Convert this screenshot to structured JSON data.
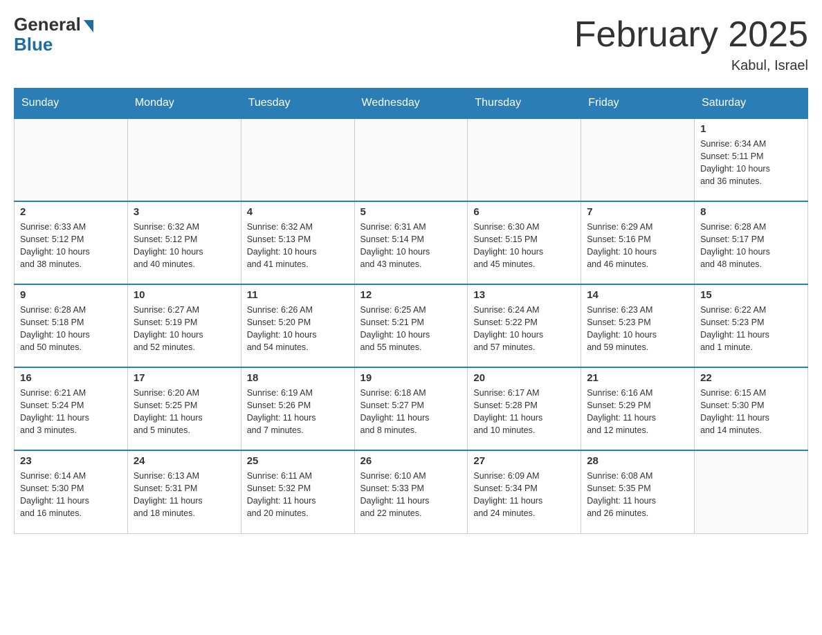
{
  "header": {
    "logo_general": "General",
    "logo_blue": "Blue",
    "month_title": "February 2025",
    "location": "Kabul, Israel"
  },
  "calendar": {
    "days_of_week": [
      "Sunday",
      "Monday",
      "Tuesday",
      "Wednesday",
      "Thursday",
      "Friday",
      "Saturday"
    ],
    "weeks": [
      [
        {
          "day": "",
          "info": ""
        },
        {
          "day": "",
          "info": ""
        },
        {
          "day": "",
          "info": ""
        },
        {
          "day": "",
          "info": ""
        },
        {
          "day": "",
          "info": ""
        },
        {
          "day": "",
          "info": ""
        },
        {
          "day": "1",
          "info": "Sunrise: 6:34 AM\nSunset: 5:11 PM\nDaylight: 10 hours\nand 36 minutes."
        }
      ],
      [
        {
          "day": "2",
          "info": "Sunrise: 6:33 AM\nSunset: 5:12 PM\nDaylight: 10 hours\nand 38 minutes."
        },
        {
          "day": "3",
          "info": "Sunrise: 6:32 AM\nSunset: 5:12 PM\nDaylight: 10 hours\nand 40 minutes."
        },
        {
          "day": "4",
          "info": "Sunrise: 6:32 AM\nSunset: 5:13 PM\nDaylight: 10 hours\nand 41 minutes."
        },
        {
          "day": "5",
          "info": "Sunrise: 6:31 AM\nSunset: 5:14 PM\nDaylight: 10 hours\nand 43 minutes."
        },
        {
          "day": "6",
          "info": "Sunrise: 6:30 AM\nSunset: 5:15 PM\nDaylight: 10 hours\nand 45 minutes."
        },
        {
          "day": "7",
          "info": "Sunrise: 6:29 AM\nSunset: 5:16 PM\nDaylight: 10 hours\nand 46 minutes."
        },
        {
          "day": "8",
          "info": "Sunrise: 6:28 AM\nSunset: 5:17 PM\nDaylight: 10 hours\nand 48 minutes."
        }
      ],
      [
        {
          "day": "9",
          "info": "Sunrise: 6:28 AM\nSunset: 5:18 PM\nDaylight: 10 hours\nand 50 minutes."
        },
        {
          "day": "10",
          "info": "Sunrise: 6:27 AM\nSunset: 5:19 PM\nDaylight: 10 hours\nand 52 minutes."
        },
        {
          "day": "11",
          "info": "Sunrise: 6:26 AM\nSunset: 5:20 PM\nDaylight: 10 hours\nand 54 minutes."
        },
        {
          "day": "12",
          "info": "Sunrise: 6:25 AM\nSunset: 5:21 PM\nDaylight: 10 hours\nand 55 minutes."
        },
        {
          "day": "13",
          "info": "Sunrise: 6:24 AM\nSunset: 5:22 PM\nDaylight: 10 hours\nand 57 minutes."
        },
        {
          "day": "14",
          "info": "Sunrise: 6:23 AM\nSunset: 5:23 PM\nDaylight: 10 hours\nand 59 minutes."
        },
        {
          "day": "15",
          "info": "Sunrise: 6:22 AM\nSunset: 5:23 PM\nDaylight: 11 hours\nand 1 minute."
        }
      ],
      [
        {
          "day": "16",
          "info": "Sunrise: 6:21 AM\nSunset: 5:24 PM\nDaylight: 11 hours\nand 3 minutes."
        },
        {
          "day": "17",
          "info": "Sunrise: 6:20 AM\nSunset: 5:25 PM\nDaylight: 11 hours\nand 5 minutes."
        },
        {
          "day": "18",
          "info": "Sunrise: 6:19 AM\nSunset: 5:26 PM\nDaylight: 11 hours\nand 7 minutes."
        },
        {
          "day": "19",
          "info": "Sunrise: 6:18 AM\nSunset: 5:27 PM\nDaylight: 11 hours\nand 8 minutes."
        },
        {
          "day": "20",
          "info": "Sunrise: 6:17 AM\nSunset: 5:28 PM\nDaylight: 11 hours\nand 10 minutes."
        },
        {
          "day": "21",
          "info": "Sunrise: 6:16 AM\nSunset: 5:29 PM\nDaylight: 11 hours\nand 12 minutes."
        },
        {
          "day": "22",
          "info": "Sunrise: 6:15 AM\nSunset: 5:30 PM\nDaylight: 11 hours\nand 14 minutes."
        }
      ],
      [
        {
          "day": "23",
          "info": "Sunrise: 6:14 AM\nSunset: 5:30 PM\nDaylight: 11 hours\nand 16 minutes."
        },
        {
          "day": "24",
          "info": "Sunrise: 6:13 AM\nSunset: 5:31 PM\nDaylight: 11 hours\nand 18 minutes."
        },
        {
          "day": "25",
          "info": "Sunrise: 6:11 AM\nSunset: 5:32 PM\nDaylight: 11 hours\nand 20 minutes."
        },
        {
          "day": "26",
          "info": "Sunrise: 6:10 AM\nSunset: 5:33 PM\nDaylight: 11 hours\nand 22 minutes."
        },
        {
          "day": "27",
          "info": "Sunrise: 6:09 AM\nSunset: 5:34 PM\nDaylight: 11 hours\nand 24 minutes."
        },
        {
          "day": "28",
          "info": "Sunrise: 6:08 AM\nSunset: 5:35 PM\nDaylight: 11 hours\nand 26 minutes."
        },
        {
          "day": "",
          "info": ""
        }
      ]
    ]
  }
}
